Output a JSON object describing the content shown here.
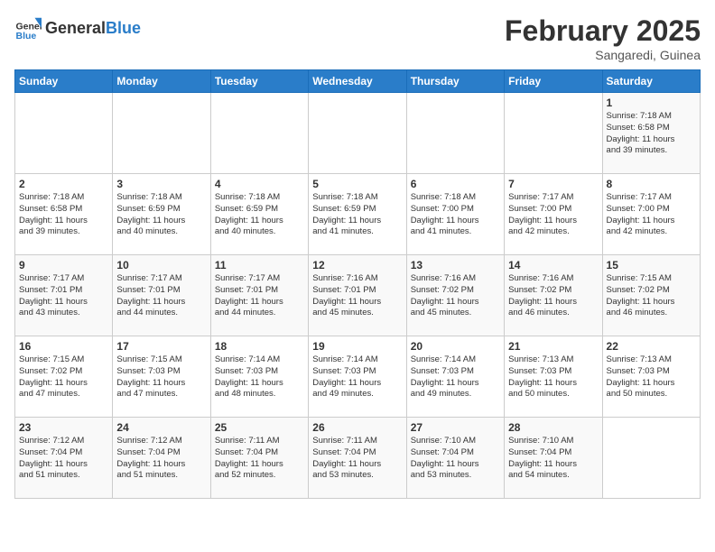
{
  "header": {
    "logo_general": "General",
    "logo_blue": "Blue",
    "month_title": "February 2025",
    "subtitle": "Sangaredi, Guinea"
  },
  "days_of_week": [
    "Sunday",
    "Monday",
    "Tuesday",
    "Wednesday",
    "Thursday",
    "Friday",
    "Saturday"
  ],
  "weeks": [
    [
      {
        "day": "",
        "info": ""
      },
      {
        "day": "",
        "info": ""
      },
      {
        "day": "",
        "info": ""
      },
      {
        "day": "",
        "info": ""
      },
      {
        "day": "",
        "info": ""
      },
      {
        "day": "",
        "info": ""
      },
      {
        "day": "1",
        "info": "Sunrise: 7:18 AM\nSunset: 6:58 PM\nDaylight: 11 hours\nand 39 minutes."
      }
    ],
    [
      {
        "day": "2",
        "info": "Sunrise: 7:18 AM\nSunset: 6:58 PM\nDaylight: 11 hours\nand 39 minutes."
      },
      {
        "day": "3",
        "info": "Sunrise: 7:18 AM\nSunset: 6:59 PM\nDaylight: 11 hours\nand 40 minutes."
      },
      {
        "day": "4",
        "info": "Sunrise: 7:18 AM\nSunset: 6:59 PM\nDaylight: 11 hours\nand 40 minutes."
      },
      {
        "day": "5",
        "info": "Sunrise: 7:18 AM\nSunset: 6:59 PM\nDaylight: 11 hours\nand 41 minutes."
      },
      {
        "day": "6",
        "info": "Sunrise: 7:18 AM\nSunset: 7:00 PM\nDaylight: 11 hours\nand 41 minutes."
      },
      {
        "day": "7",
        "info": "Sunrise: 7:17 AM\nSunset: 7:00 PM\nDaylight: 11 hours\nand 42 minutes."
      },
      {
        "day": "8",
        "info": "Sunrise: 7:17 AM\nSunset: 7:00 PM\nDaylight: 11 hours\nand 42 minutes."
      }
    ],
    [
      {
        "day": "9",
        "info": "Sunrise: 7:17 AM\nSunset: 7:01 PM\nDaylight: 11 hours\nand 43 minutes."
      },
      {
        "day": "10",
        "info": "Sunrise: 7:17 AM\nSunset: 7:01 PM\nDaylight: 11 hours\nand 44 minutes."
      },
      {
        "day": "11",
        "info": "Sunrise: 7:17 AM\nSunset: 7:01 PM\nDaylight: 11 hours\nand 44 minutes."
      },
      {
        "day": "12",
        "info": "Sunrise: 7:16 AM\nSunset: 7:01 PM\nDaylight: 11 hours\nand 45 minutes."
      },
      {
        "day": "13",
        "info": "Sunrise: 7:16 AM\nSunset: 7:02 PM\nDaylight: 11 hours\nand 45 minutes."
      },
      {
        "day": "14",
        "info": "Sunrise: 7:16 AM\nSunset: 7:02 PM\nDaylight: 11 hours\nand 46 minutes."
      },
      {
        "day": "15",
        "info": "Sunrise: 7:15 AM\nSunset: 7:02 PM\nDaylight: 11 hours\nand 46 minutes."
      }
    ],
    [
      {
        "day": "16",
        "info": "Sunrise: 7:15 AM\nSunset: 7:02 PM\nDaylight: 11 hours\nand 47 minutes."
      },
      {
        "day": "17",
        "info": "Sunrise: 7:15 AM\nSunset: 7:03 PM\nDaylight: 11 hours\nand 47 minutes."
      },
      {
        "day": "18",
        "info": "Sunrise: 7:14 AM\nSunset: 7:03 PM\nDaylight: 11 hours\nand 48 minutes."
      },
      {
        "day": "19",
        "info": "Sunrise: 7:14 AM\nSunset: 7:03 PM\nDaylight: 11 hours\nand 49 minutes."
      },
      {
        "day": "20",
        "info": "Sunrise: 7:14 AM\nSunset: 7:03 PM\nDaylight: 11 hours\nand 49 minutes."
      },
      {
        "day": "21",
        "info": "Sunrise: 7:13 AM\nSunset: 7:03 PM\nDaylight: 11 hours\nand 50 minutes."
      },
      {
        "day": "22",
        "info": "Sunrise: 7:13 AM\nSunset: 7:03 PM\nDaylight: 11 hours\nand 50 minutes."
      }
    ],
    [
      {
        "day": "23",
        "info": "Sunrise: 7:12 AM\nSunset: 7:04 PM\nDaylight: 11 hours\nand 51 minutes."
      },
      {
        "day": "24",
        "info": "Sunrise: 7:12 AM\nSunset: 7:04 PM\nDaylight: 11 hours\nand 51 minutes."
      },
      {
        "day": "25",
        "info": "Sunrise: 7:11 AM\nSunset: 7:04 PM\nDaylight: 11 hours\nand 52 minutes."
      },
      {
        "day": "26",
        "info": "Sunrise: 7:11 AM\nSunset: 7:04 PM\nDaylight: 11 hours\nand 53 minutes."
      },
      {
        "day": "27",
        "info": "Sunrise: 7:10 AM\nSunset: 7:04 PM\nDaylight: 11 hours\nand 53 minutes."
      },
      {
        "day": "28",
        "info": "Sunrise: 7:10 AM\nSunset: 7:04 PM\nDaylight: 11 hours\nand 54 minutes."
      },
      {
        "day": "",
        "info": ""
      }
    ]
  ]
}
